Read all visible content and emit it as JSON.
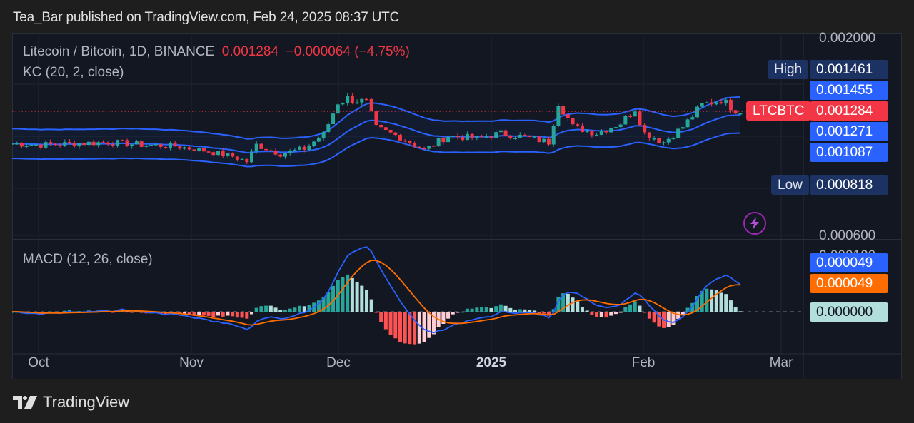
{
  "header": {
    "published_by": "Tea_Bar published on TradingView.com, Feb 24, 2025 08:37 UTC"
  },
  "main_pane": {
    "symbol_title": "Litecoin / Bitcoin, 1D, BINANCE",
    "last_price": "0.001284",
    "change": "−0.000064 (−4.75%)",
    "indicator": "KC (20, 2, close)"
  },
  "price_axis": {
    "top_label": "0.002000",
    "bottom_label": "0.000600",
    "high_label": "High",
    "high_value": "0.001461",
    "kc_upper": "0.001455",
    "symbol_tag": "LTCBTC",
    "last_value": "0.001284",
    "kc_middle": "0.001271",
    "kc_lower": "0.001087",
    "low_label": "Low",
    "low_value": "0.000818"
  },
  "macd_pane": {
    "title": "MACD (12, 26, close)",
    "top_label": "0.000100",
    "macd_value": "0.000049",
    "signal_value": "0.000049",
    "zero_value": "0.000000"
  },
  "time_axis": {
    "labels": [
      "Oct",
      "Nov",
      "Dec",
      "2025",
      "Feb",
      "Mar"
    ]
  },
  "footer": {
    "brand": "TradingView"
  },
  "colors": {
    "up": "#26a69a",
    "down": "#f23645",
    "kc_band": "#2962ff",
    "macd_line": "#2962ff",
    "signal_line": "#ff6d00",
    "hist_up_strong": "#26a69a",
    "hist_up_weak": "#b2dfdb",
    "hist_down_strong": "#ff5252",
    "hist_down_weak": "#ffcdd2",
    "last_price_tag": "#f23645",
    "high_low_tag": "#1c3263",
    "bolt": "#9c27b0"
  },
  "chart_data": [
    {
      "type": "candlestick",
      "title": "Litecoin / Bitcoin, 1D, BINANCE",
      "x_range": [
        "2024-09-25",
        "2025-02-24"
      ],
      "y_range": [
        0.0006,
        0.002
      ],
      "x_ticks": [
        "Oct",
        "Nov",
        "Dec",
        "2025",
        "Feb",
        "Mar"
      ],
      "y_ticks": [
        0.0006,
        0.002
      ],
      "last": 0.001284,
      "high": 0.001461,
      "low": 0.000818,
      "series_close_approx": {
        "dates": [
          "2024-09-25",
          "2024-10-01",
          "2024-10-08",
          "2024-10-15",
          "2024-10-22",
          "2024-10-29",
          "2024-11-05",
          "2024-11-10",
          "2024-11-13",
          "2024-11-15",
          "2024-11-20",
          "2024-11-25",
          "2024-11-29",
          "2024-12-02",
          "2024-12-04",
          "2024-12-08",
          "2024-12-10",
          "2024-12-15",
          "2024-12-20",
          "2024-12-25",
          "2024-12-31",
          "2025-01-05",
          "2025-01-10",
          "2025-01-15",
          "2025-01-17",
          "2025-01-20",
          "2025-01-25",
          "2025-01-30",
          "2025-02-02",
          "2025-02-04",
          "2025-02-08",
          "2025-02-12",
          "2025-02-16",
          "2025-02-20",
          "2025-02-24"
        ],
        "close": [
          0.00105,
          0.00104,
          0.00105,
          0.00106,
          0.00104,
          0.00103,
          0.00099,
          0.00095,
          0.00091,
          0.00104,
          0.00097,
          0.00101,
          0.00112,
          0.00137,
          0.0014,
          0.00137,
          0.00117,
          0.0011,
          0.001,
          0.00111,
          0.00109,
          0.00113,
          0.0011,
          0.00106,
          0.00137,
          0.00118,
          0.00113,
          0.00121,
          0.00132,
          0.00113,
          0.00106,
          0.00118,
          0.00135,
          0.00139,
          0.001284
        ]
      },
      "keltner_channel": {
        "params": "20, 2, close",
        "upper_last": 0.001455,
        "middle_last": 0.001271,
        "lower_last": 0.001087
      }
    },
    {
      "type": "bar+line",
      "title": "MACD (12, 26, close)",
      "series": [
        {
          "name": "MACD",
          "last": 4.9e-05
        },
        {
          "name": "Signal",
          "last": 4.9e-05
        },
        {
          "name": "Histogram",
          "last": 0.0
        }
      ],
      "zero_line": 0.0,
      "y_ticks": [
        0.0001
      ]
    }
  ]
}
